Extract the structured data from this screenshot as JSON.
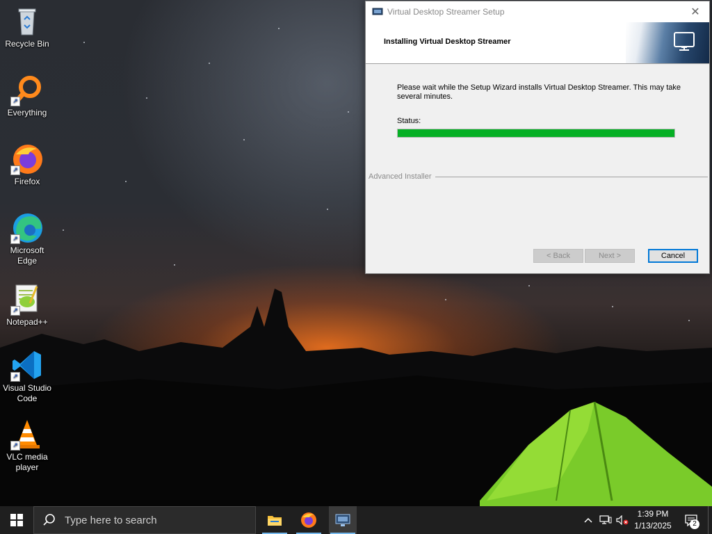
{
  "desktop": {
    "icons": [
      {
        "label": "Recycle Bin"
      },
      {
        "label": "Everything"
      },
      {
        "label": "Firefox"
      },
      {
        "label": "Microsoft Edge"
      },
      {
        "label": "Notepad++"
      },
      {
        "label": "Visual Studio Code"
      },
      {
        "label": "VLC media player"
      }
    ]
  },
  "window": {
    "title": "Virtual Desktop Streamer Setup",
    "close_glyph": "✕",
    "heading": "Installing Virtual Desktop Streamer",
    "message": "Please wait while the Setup Wizard installs Virtual Desktop Streamer.  This may take several minutes.",
    "status_label": "Status:",
    "progress_percent": 100,
    "brand": "Advanced Installer",
    "buttons": {
      "back": "< Back",
      "next": "Next >",
      "cancel": "Cancel"
    }
  },
  "taskbar": {
    "search_placeholder": "Type here to search",
    "apps": [
      "file-explorer",
      "firefox",
      "virtual-desktop-setup"
    ],
    "clock_time": "1:39 PM",
    "clock_date": "1/13/2025",
    "notification_count": "2"
  },
  "colors": {
    "progress_fill": "#06b025",
    "accent": "#0078d7",
    "taskbar": "#1f1f1f"
  }
}
